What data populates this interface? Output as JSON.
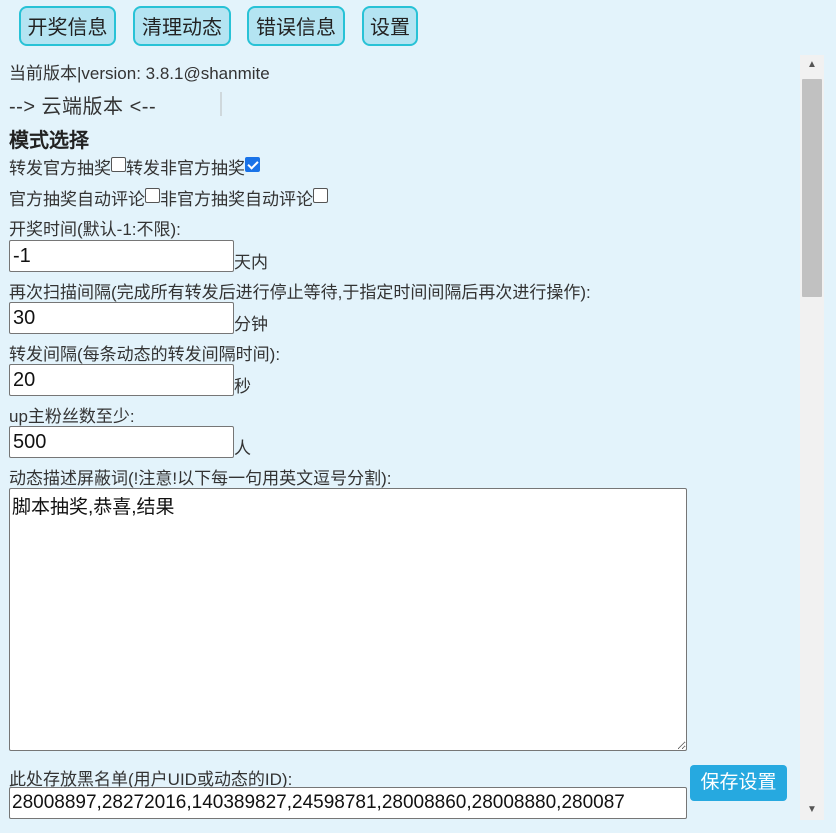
{
  "toolbar": {
    "lottery_info": "开奖信息",
    "clear_dynamics": "清理动态",
    "error_info": "错误信息",
    "settings": "设置"
  },
  "version_line": "当前版本|version: 3.8.1@shanmite",
  "cloud_version": "--> 云端版本 <--",
  "mode": {
    "title": "模式选择",
    "forward_official": {
      "label": "转发官方抽奖",
      "checked": false
    },
    "forward_unofficial": {
      "label": "转发非官方抽奖",
      "checked": true
    },
    "comment_official": {
      "label": "官方抽奖自动评论",
      "checked": false
    },
    "comment_unofficial": {
      "label": "非官方抽奖自动评论",
      "checked": false
    }
  },
  "fields": {
    "draw_time": {
      "label": "开奖时间(默认-1:不限):",
      "value": "-1",
      "unit": "天内"
    },
    "scan_interval": {
      "label": "再次扫描间隔(完成所有转发后进行停止等待,于指定时间间隔后再次进行操作):",
      "value": "30",
      "unit": "分钟"
    },
    "forward_interval": {
      "label": "转发间隔(每条动态的转发间隔时间):",
      "value": "20",
      "unit": "秒"
    },
    "min_fans": {
      "label": "up主粉丝数至少:",
      "value": "500",
      "unit": "人"
    },
    "block_words": {
      "label": "动态描述屏蔽词(!注意!以下每一句用英文逗号分割):",
      "value": "脚本抽奖,恭喜,结果"
    },
    "blacklist": {
      "label": "此处存放黑名单(用户UID或动态的ID):",
      "value": "28008897,28272016,140389827,24598781,28008860,28008880,280087"
    }
  },
  "save_button": "保存设置",
  "colors": {
    "background": "#e3f3fb",
    "toolbar_button_bg": "#b4e4f2",
    "toolbar_button_border": "#28c2d6",
    "save_button_bg": "#26a9e0",
    "checkbox_checked": "#1a73e8"
  }
}
